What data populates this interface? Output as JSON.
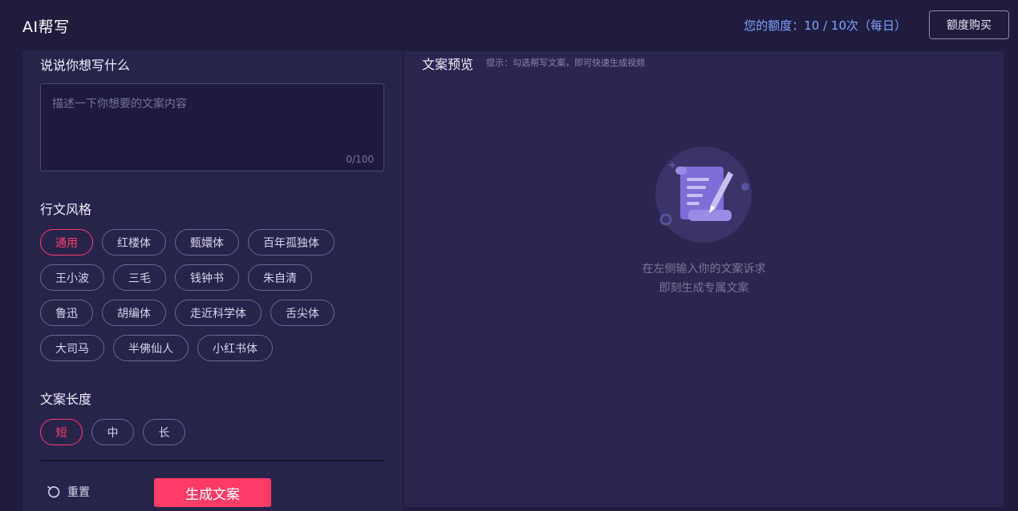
{
  "header": {
    "app_title": "AI帮写",
    "quota_text": "您的额度：10 / 10次（每日）",
    "buy_label": "额度购买"
  },
  "left": {
    "prompt_title": "说说你想写什么",
    "prompt_placeholder": "描述一下你想要的文案内容",
    "prompt_value": "",
    "counter": "0/100",
    "style_title": "行文风格",
    "style_rows": [
      [
        {
          "label": "通用",
          "active": true
        },
        {
          "label": "红楼体"
        },
        {
          "label": "甄嬛体"
        },
        {
          "label": "百年孤独体"
        }
      ],
      [
        {
          "label": "王小波"
        },
        {
          "label": "三毛"
        },
        {
          "label": "钱钟书"
        },
        {
          "label": "朱自清"
        }
      ],
      [
        {
          "label": "鲁迅"
        },
        {
          "label": "胡编体"
        },
        {
          "label": "走近科学体"
        },
        {
          "label": "舌尖体"
        }
      ],
      [
        {
          "label": "大司马"
        },
        {
          "label": "半佛仙人"
        },
        {
          "label": "小红书体"
        }
      ]
    ],
    "length_title": "文案长度",
    "lengths": [
      {
        "label": "短",
        "active": true
      },
      {
        "label": "中"
      },
      {
        "label": "长"
      }
    ],
    "reset_label": "重置",
    "generate_label": "生成文案"
  },
  "right": {
    "preview_title": "文案预览",
    "preview_hint": "提示：勾选帮写文案，即可快速生成视频",
    "empty_line1": "在左侧输入你的文案诉求",
    "empty_line2": "即刻生成专属文案"
  },
  "colors": {
    "accent": "#ff3b66",
    "quota": "#7fa6ff",
    "background": "#1f1c3d"
  }
}
